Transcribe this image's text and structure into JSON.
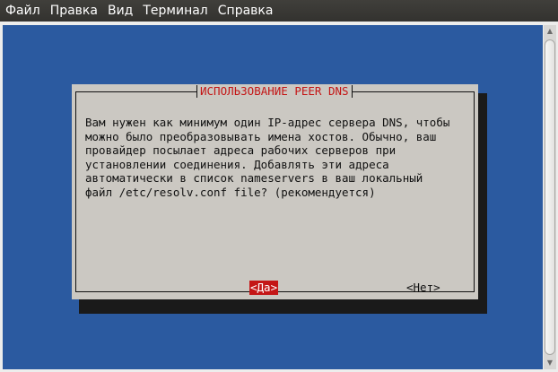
{
  "menubar": {
    "items": [
      "Файл",
      "Правка",
      "Вид",
      "Терминал",
      "Справка"
    ]
  },
  "scrollbar": {
    "up_icon": "▲",
    "down_icon": "▼"
  },
  "dialog": {
    "title": "ИСПОЛЬЗОВАНИЕ PEER DNS",
    "lines": [
      "Вам нужен как минимум один IP-адрес сервера DNS, чтобы",
      "можно было преобразовывать имена хостов. Обычно, ваш",
      "провайдер посылает адреса рабочих серверов при",
      "установлении соединения. Добавлять эти адреса",
      "автоматически в список nameservers в ваш локальный",
      "файл /etc/resolv.conf file? (рекомендуется)"
    ],
    "yes_label": "<Да>",
    "no_label": "<Нет>"
  },
  "colors": {
    "terminal_bg": "#2b5aa0",
    "dialog_bg": "#cbc8c2",
    "accent_red": "#c41616",
    "menubar_bg": "#3c3b37"
  }
}
